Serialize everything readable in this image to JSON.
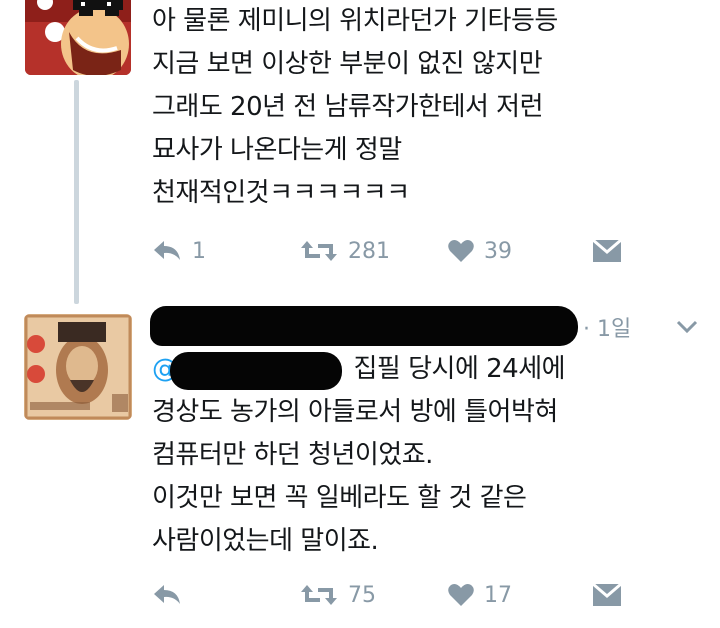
{
  "colors": {
    "text": "#14171a",
    "secondary": "#8899a6",
    "link": "#1da1f2",
    "thread_line": "#ccd6dd"
  },
  "tweet1": {
    "lines": [
      "아 물론 제미니의 위치라던가 기타등등",
      "지금 보면 이상한 부분이 없진 않지만",
      "그래도 20년 전 남류작가한테서 저런",
      "묘사가 나온다는게 정말",
      "천재적인것ㅋㅋㅋㅋㅋㅋ"
    ],
    "actions": {
      "reply_count": "1",
      "retweet_count": "281",
      "like_count": "39"
    }
  },
  "tweet2": {
    "timestamp": "· 1일",
    "mention_prefix": "@",
    "first_line_rest": "집필 당시에 24세에",
    "lines": [
      "경상도 농가의 아들로서 방에 틀어박혀",
      "컴퓨터만 하던 청년이었죠.",
      "이것만 보면 꼭 일베라도 할 것 같은",
      "사람이었는데 말이죠."
    ],
    "actions": {
      "reply_count": "",
      "retweet_count": "75",
      "like_count": "17"
    }
  },
  "icons": {
    "reply": "reply-icon",
    "retweet": "retweet-icon",
    "like": "heart-icon",
    "dm": "envelope-icon",
    "more": "chevron-down-icon"
  }
}
